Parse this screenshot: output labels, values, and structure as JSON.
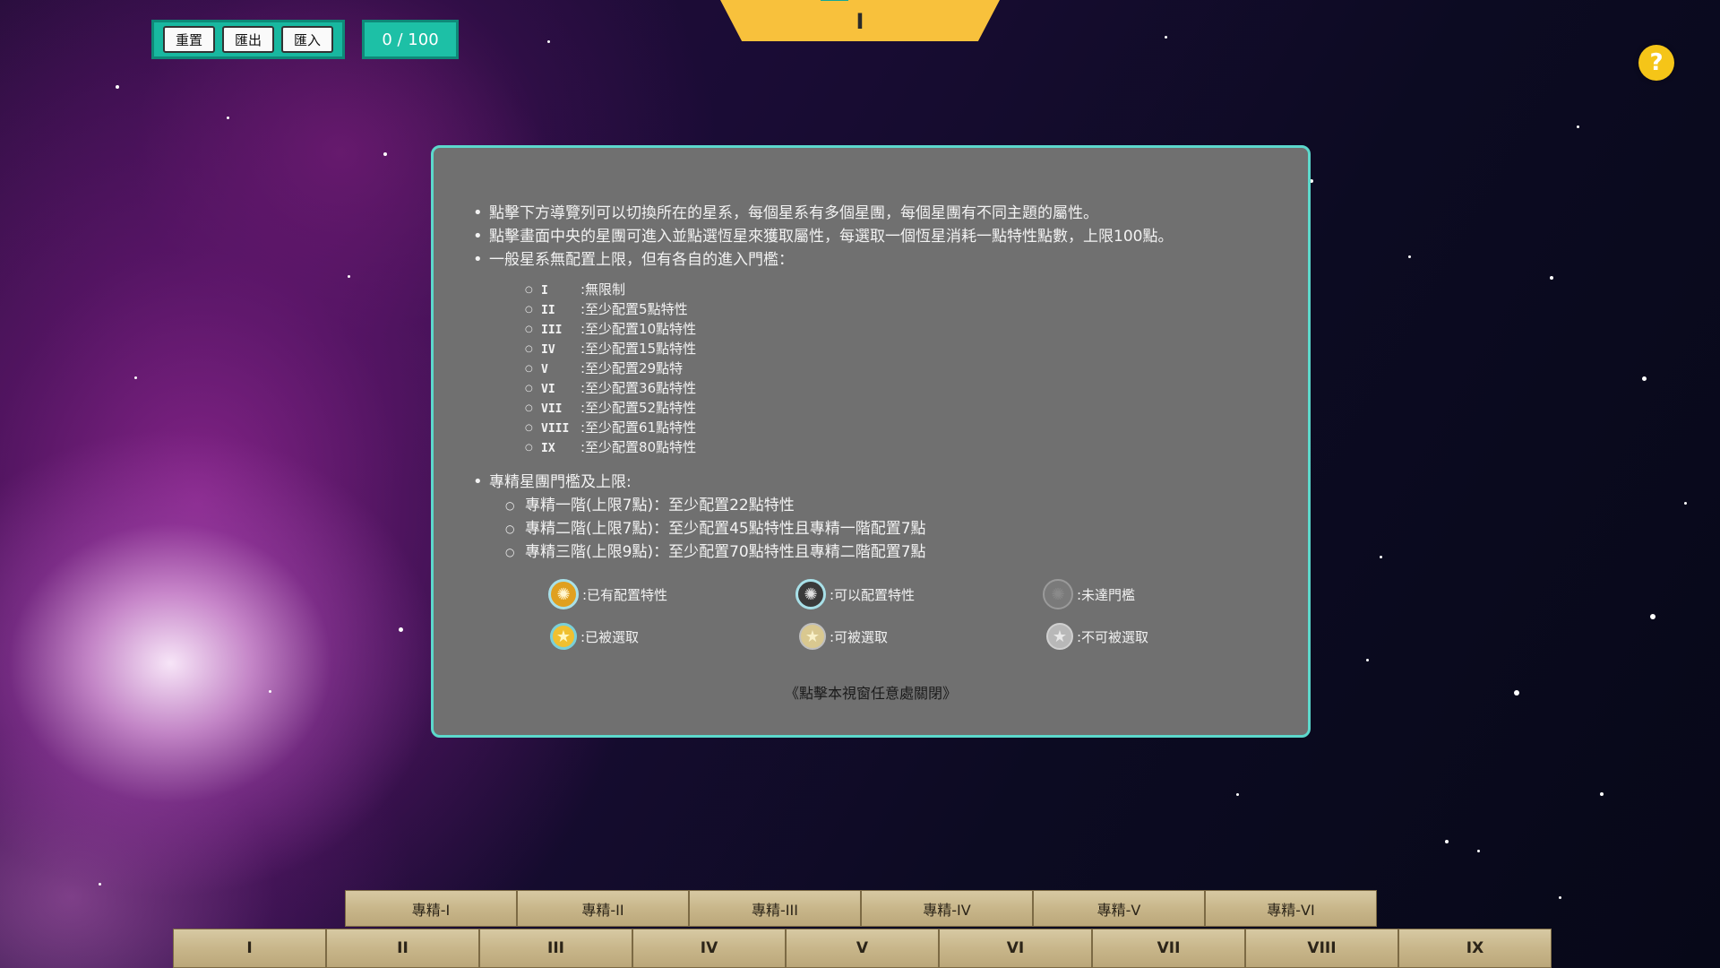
{
  "toolbar": {
    "reset_label": "重置",
    "export_label": "匯出",
    "import_label": "匯入"
  },
  "points_counter": "0 / 100",
  "current_galaxy": "I",
  "help_label": "?",
  "help_modal": {
    "rules": [
      "點擊下方導覽列可以切換所在的星系，每個星系有多個星團，每個星團有不同主題的屬性。",
      "點擊畫面中央的星團可進入並點選恆星來獲取屬性，每選取一個恆星消耗一點特性點數，上限100點。",
      "一般星系無配置上限，但有各自的進入門檻："
    ],
    "thresholds": [
      {
        "galaxy": "I",
        "text": ":無限制"
      },
      {
        "galaxy": "II",
        "text": ":至少配置5點特性"
      },
      {
        "galaxy": "III",
        "text": ":至少配置10點特性"
      },
      {
        "galaxy": "IV",
        "text": ":至少配置15點特性"
      },
      {
        "galaxy": "V",
        "text": ":至少配置29點特"
      },
      {
        "galaxy": "VI",
        "text": ":至少配置36點特性"
      },
      {
        "galaxy": "VII",
        "text": ":至少配置52點特性"
      },
      {
        "galaxy": "VIII",
        "text": ":至少配置61點特性"
      },
      {
        "galaxy": "IX",
        "text": ":至少配置80點特性"
      }
    ],
    "spec_heading": "專精星團門檻及上限:",
    "spec_rules": [
      "專精一階(上限7點)：至少配置22點特性",
      "專精二階(上限7點)：至少配置45點特性且專精一階配置7點",
      "專精三階(上限9點)：至少配置70點特性且專精二階配置7點"
    ],
    "legend": {
      "has_points": ":已有配置特性",
      "can_assign": ":可以配置特性",
      "below_threshold": ":未達門檻",
      "selected": ":已被選取",
      "selectable": ":可被選取",
      "not_selectable": ":不可被選取"
    },
    "close_hint": "《點擊本視窗任意處關閉》"
  },
  "spec_tabs": [
    "專精-I",
    "專精-II",
    "專精-III",
    "專精-IV",
    "專精-V",
    "專精-VI"
  ],
  "galaxy_tabs": [
    "I",
    "II",
    "III",
    "IV",
    "V",
    "VI",
    "VII",
    "VIII",
    "IX"
  ],
  "colors": {
    "toolbar_accent": "#18b8a0",
    "galaxy_tab": "#f8c13c",
    "help_button": "#f5c518",
    "modal_bg": "#707070",
    "modal_border": "#5cd8cc",
    "nav_tab": "#c8b68a"
  }
}
